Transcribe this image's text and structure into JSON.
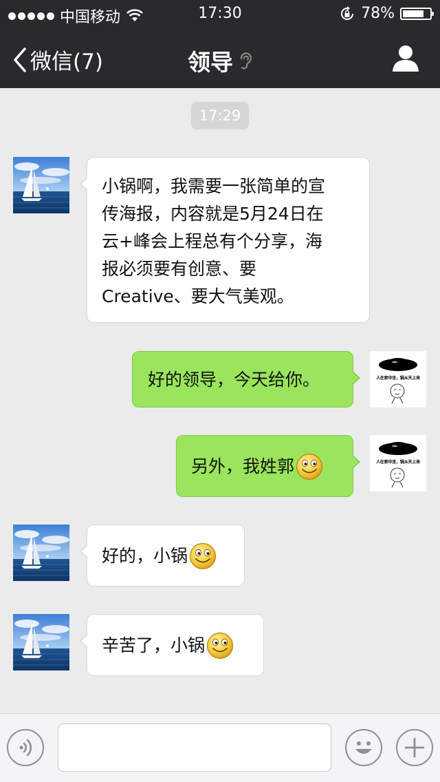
{
  "status_bar": {
    "carrier": "中国移动",
    "time": "17:30",
    "battery": "78%",
    "battery_level": 0.78
  },
  "nav": {
    "back_label": "微信(7)",
    "title": "领导"
  },
  "chat": {
    "timestamp": "17:29",
    "messages": [
      {
        "direction": "in",
        "lines": [
          "小锅啊，我需要一张简单的宣",
          "传海报，内容就是5月24日在",
          "云+峰会上程总有个分享，海",
          "报必须要有创意、要",
          "Creative、要大气美观。"
        ]
      },
      {
        "direction": "out",
        "text": "好的领导，今天给你。"
      },
      {
        "direction": "out",
        "text": "另外，我姓郭",
        "emoji": "smile-emoji"
      },
      {
        "direction": "in",
        "text": "好的，小锅",
        "emoji": "smile-emoji"
      },
      {
        "direction": "in",
        "text": "辛苦了，小锅",
        "emoji": "smile-emoji"
      }
    ],
    "self_avatar_caption": "人在家中坐，锅从天上来"
  },
  "input_bar": {
    "voice_icon": "voice-icon",
    "emoji_icon": "emoji-face-icon",
    "plus_icon": "plus-icon"
  }
}
